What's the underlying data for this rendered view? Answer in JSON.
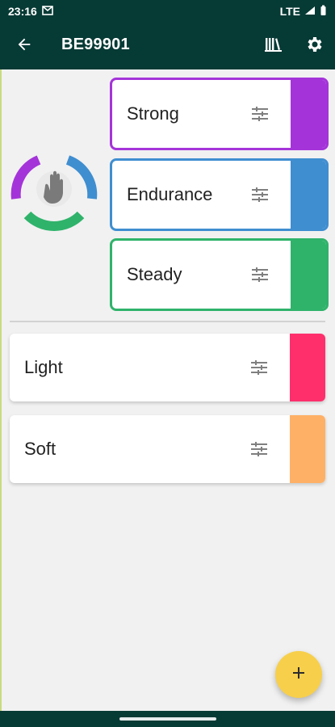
{
  "status": {
    "time": "23:16",
    "network": "LTE"
  },
  "appbar": {
    "title": "BE99901"
  },
  "groups": {
    "outlined": [
      {
        "label": "Strong",
        "color": "#a434d9"
      },
      {
        "label": "Endurance",
        "color": "#3f8ed0"
      },
      {
        "label": "Steady",
        "color": "#2fb36b"
      }
    ],
    "plain": [
      {
        "label": "Light",
        "color": "#ff2f6c"
      },
      {
        "label": "Soft",
        "color": "#ffb067"
      }
    ]
  },
  "fab": {
    "label": "+"
  },
  "icons": {
    "back": "arrow-left-icon",
    "library": "library-icon",
    "settings": "gear-icon",
    "tune": "tune-sliders-icon",
    "add": "plus-icon",
    "status_mail": "mail-icon",
    "status_signal": "signal-icon",
    "status_battery": "battery-icon",
    "hand": "hand-icon"
  },
  "theme": {
    "dark": "#063a35",
    "fab": "#f7cf4b"
  }
}
